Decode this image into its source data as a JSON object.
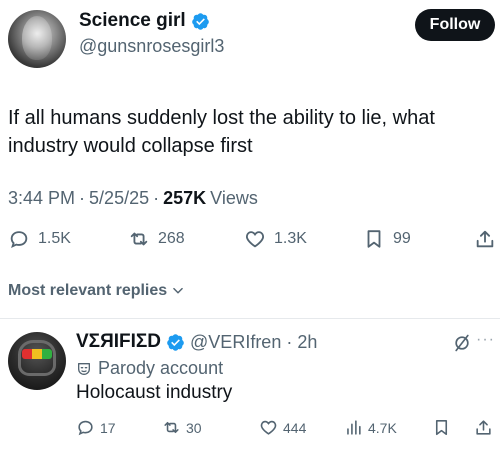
{
  "tweet": {
    "author_name": "Science girl",
    "handle": "@gunsnrosesgirl3",
    "follow_label": "Follow",
    "text": "If all humans suddenly lost the ability to lie, what industry would collapse first",
    "time": "3:44 PM",
    "date": "5/25/25",
    "views_count": "257K",
    "views_label": "Views",
    "stats": {
      "replies": "1.5K",
      "reposts": "268",
      "likes": "1.3K",
      "bookmarks": "99"
    },
    "icons": [
      "verified-badge-icon",
      "reply-icon",
      "repost-icon",
      "like-icon",
      "bookmark-icon",
      "share-icon"
    ]
  },
  "replies_sort": {
    "label": "Most relevant replies"
  },
  "reply": {
    "author_name": "VΣЯIFIΣD",
    "handle": "@VERIfren",
    "time": "2h",
    "parody_label": "Parody account",
    "text": "Holocaust industry",
    "more": "···",
    "stats": {
      "replies": "17",
      "reposts": "30",
      "likes": "444",
      "views": "4.7K"
    }
  },
  "colors": {
    "text": "#0f1419",
    "secondary": "#536471",
    "verified": "#1d9bf0",
    "follow_bg": "#0f1419",
    "divider": "#e6e9ec"
  }
}
